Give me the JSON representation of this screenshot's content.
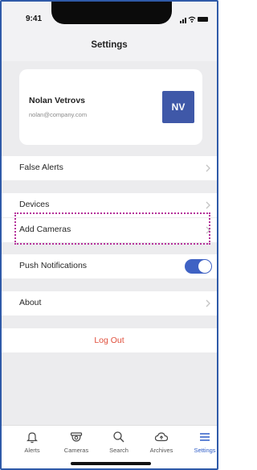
{
  "status_bar": {
    "time": "9:41"
  },
  "header": {
    "title": "Settings"
  },
  "profile": {
    "name": "Nolan Vetrovs",
    "email": "nolan@company.com",
    "initials": "NV",
    "avatar_color": "#3f58a8"
  },
  "rows": {
    "false_alerts": "False Alerts",
    "devices": "Devices",
    "add_cameras": "Add Cameras",
    "push_notifications": "Push Notifications",
    "about": "About"
  },
  "push_notifications_enabled": true,
  "logout": {
    "label": "Log Out",
    "color": "#e04f3c"
  },
  "tabbar": {
    "items": [
      {
        "label": "Alerts",
        "icon": "bell-icon"
      },
      {
        "label": "Cameras",
        "icon": "camera-dome-icon"
      },
      {
        "label": "Search",
        "icon": "search-icon"
      },
      {
        "label": "Archives",
        "icon": "cloud-upload-icon"
      },
      {
        "label": "Settings",
        "icon": "menu-icon"
      }
    ],
    "active": "Settings",
    "accent": "#2f5dc7"
  },
  "highlight_color": "#b6329b"
}
